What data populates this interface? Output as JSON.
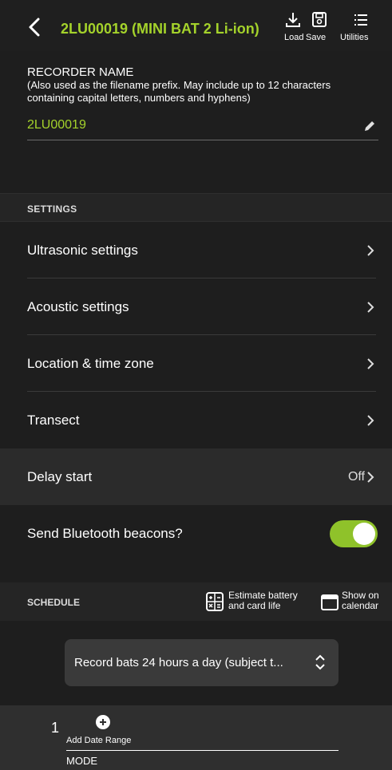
{
  "header": {
    "title": "2LU00019 (MINI BAT 2 Li-ion)",
    "load_label": "Load",
    "save_label": "Save",
    "utilities_label": "Utilities"
  },
  "recorder": {
    "title": "RECORDER NAME",
    "help": "(Also used as the filename prefix. May include up to 12 characters containing capital letters, numbers and hyphens)",
    "value": "2LU00019"
  },
  "settings": {
    "heading": "SETTINGS",
    "items": [
      {
        "label": "Ultrasonic settings"
      },
      {
        "label": "Acoustic settings"
      },
      {
        "label": "Location & time zone"
      },
      {
        "label": "Transect"
      }
    ],
    "delay_start": {
      "label": "Delay start",
      "value": "Off"
    },
    "bluetooth": {
      "label": "Send Bluetooth beacons?",
      "enabled": true
    }
  },
  "schedule": {
    "heading": "SCHEDULE",
    "estimate_line1": "Estimate battery",
    "estimate_line2": "and card life",
    "calendar_line1": "Show on",
    "calendar_line2": "calendar",
    "picker_value": "Record bats 24 hours a day (subject t...",
    "range_number": "1",
    "add_range_label": "Add Date Range",
    "mode_label": "MODE"
  },
  "colors": {
    "accent": "#a4d22b",
    "toggle_on": "#8fc22a",
    "background": "#1e1e1e"
  }
}
